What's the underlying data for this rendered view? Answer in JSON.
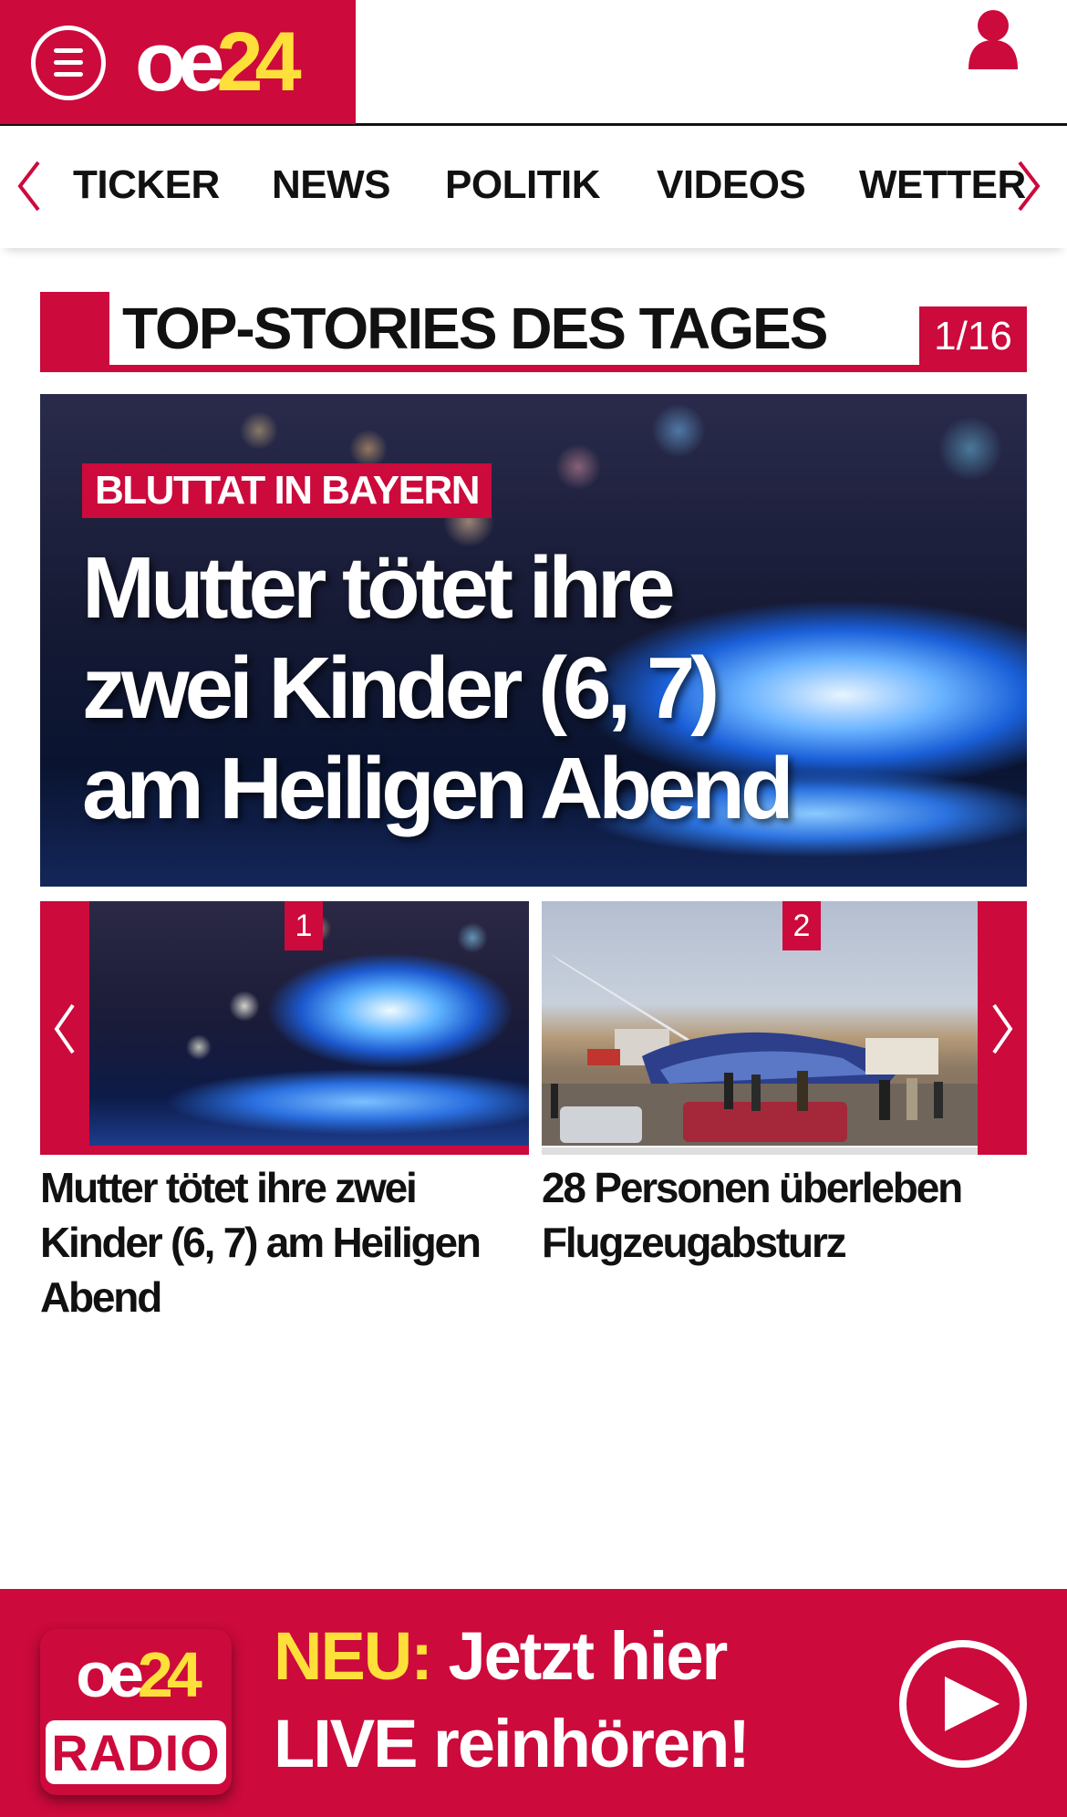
{
  "header": {
    "logo_main": "oe",
    "logo_num": "24",
    "menu_icon": "hamburger-icon",
    "user_icon": "user-icon",
    "accent_color": "#cc0a3c",
    "logo_accent_color": "#ffe03a"
  },
  "nav": {
    "items": [
      "TICKER",
      "NEWS",
      "POLITIK",
      "VIDEOS",
      "WETTER"
    ]
  },
  "section": {
    "title": "TOP-STORIES DES TAGES",
    "counter": "1/16"
  },
  "hero": {
    "tag": "BLUTTAT IN BAYERN",
    "headline": "Mutter tötet ihre zwei Kinder (6, 7) am Heiligen Abend"
  },
  "carousel": {
    "items": [
      {
        "badge": "1",
        "title": "Mutter tötet ihre zwei Kinder (6, 7) am Heiligen Abend"
      },
      {
        "badge": "2",
        "title": "28 Personen überleben Flugzeugabsturz"
      }
    ]
  },
  "radio": {
    "logo_main": "oe",
    "logo_num": "24",
    "logo_label": "RADIO",
    "highlight": "NEU:",
    "line1_rest": " Jetzt hier",
    "line2": "LIVE reinhören!",
    "play_icon": "play-icon"
  }
}
